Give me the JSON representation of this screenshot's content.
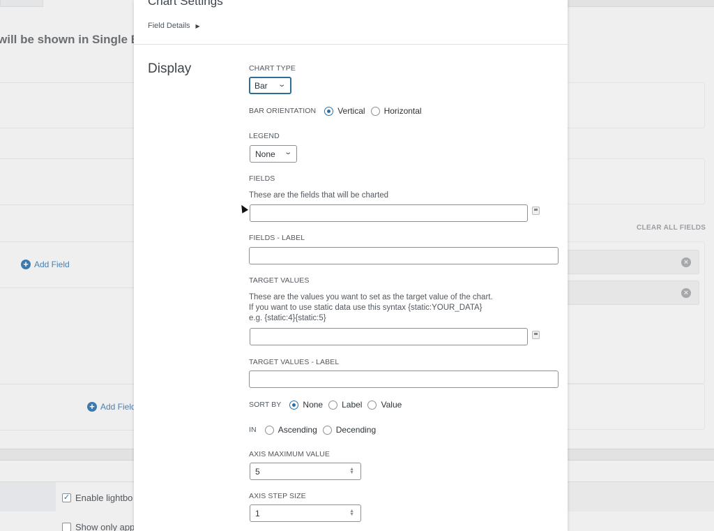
{
  "background": {
    "heading": "will be shown in Single E",
    "add_field_1": "Add Field",
    "add_field_2": "Add Field",
    "clear_all_fields": "CLEAR ALL FIELDS",
    "enable_lightbox": "Enable lightbo",
    "enable_lightbox_checked": true,
    "show_only": "Show only app",
    "show_only_checked": false
  },
  "modal": {
    "title": "Chart Settings",
    "field_details": "Field Details",
    "section_title": "Display",
    "chart_type": {
      "label": "CHART TYPE",
      "value": "Bar"
    },
    "bar_orientation": {
      "label": "BAR ORIENTATION",
      "options": [
        "Vertical",
        "Horizontal"
      ],
      "selected": "Vertical"
    },
    "legend": {
      "label": "LEGEND",
      "value": "None"
    },
    "fields": {
      "label": "FIELDS",
      "description": "These are the fields that will be charted",
      "value": ""
    },
    "fields_label": {
      "label": "FIELDS - LABEL",
      "value": ""
    },
    "target_values": {
      "label": "TARGET VALUES",
      "description_1": "These are the values you want to set as the target value of the chart.",
      "description_2": "If you want to use static data use this syntax {static:YOUR_DATA}",
      "description_3": "e.g. {static:4}{static:5}",
      "value": ""
    },
    "target_values_label": {
      "label": "TARGET VALUES - LABEL",
      "value": ""
    },
    "sort_by": {
      "label": "SORT BY",
      "options": [
        "None",
        "Label",
        "Value"
      ],
      "selected": "None"
    },
    "sort_in": {
      "label": "IN",
      "options": [
        "Ascending",
        "Decending"
      ],
      "selected": null
    },
    "axis_max": {
      "label": "AXIS MAXIMUM VALUE",
      "value": "5"
    },
    "axis_step": {
      "label": "AXIS STEP SIZE",
      "value": "1"
    }
  },
  "colors": {
    "accent": "#2271b1",
    "link": "#3d79ad",
    "focus_border": "#2f6d97"
  }
}
